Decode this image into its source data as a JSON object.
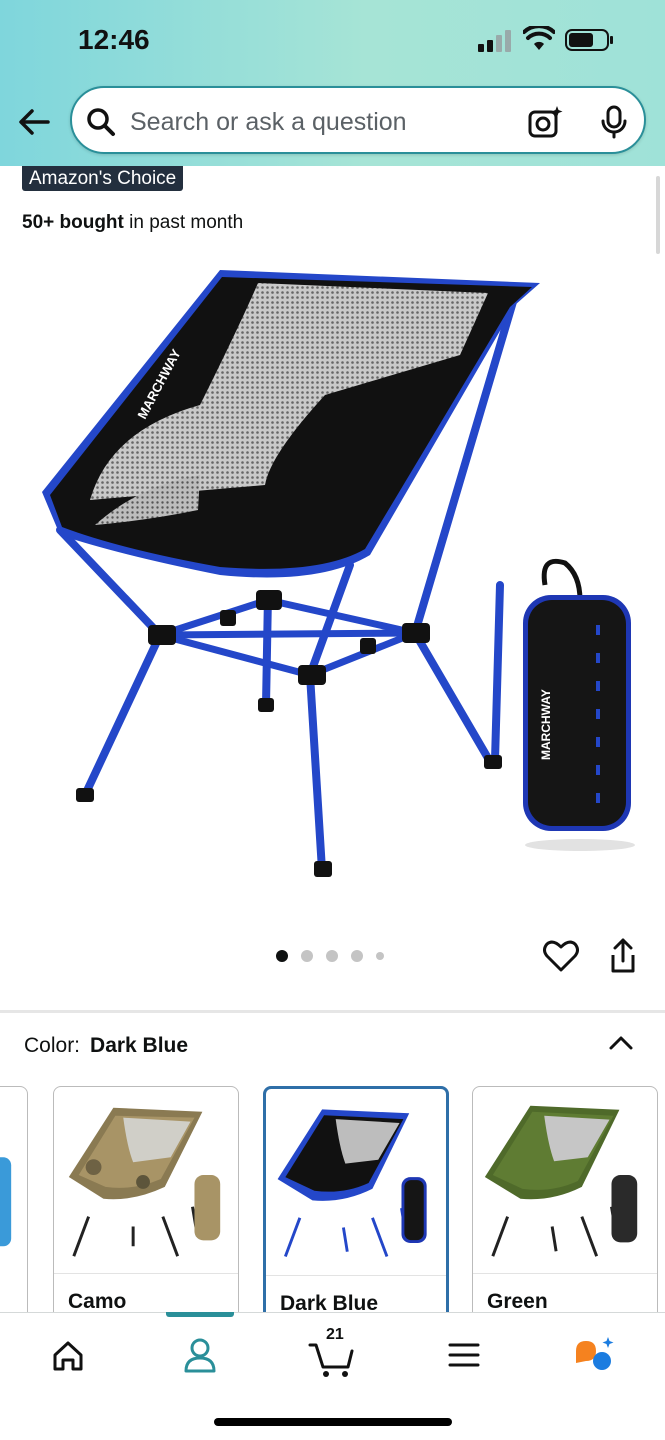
{
  "status_bar": {
    "time": "12:46"
  },
  "search": {
    "placeholder": "Search or ask a question"
  },
  "product": {
    "badge": "Amazon's Choice",
    "bought_bold": "50+ bought",
    "bought_rest": " in past month",
    "image_pages": 5,
    "active_page": 1
  },
  "color_selector": {
    "label": "Color:",
    "selected": "Dark Blue",
    "options": [
      {
        "name": "Camo"
      },
      {
        "name": "Dark Blue"
      },
      {
        "name": "Green"
      }
    ]
  },
  "bottom_nav": {
    "items": [
      "home-icon",
      "account-icon",
      "cart-icon",
      "menu-icon",
      "rufus-icon"
    ],
    "cart_count": "21",
    "active": "account"
  },
  "colors": {
    "header_gradient_start": "#7fd6dc",
    "header_gradient_end": "#9fe2d8",
    "accent": "#2a8f99",
    "badge_bg": "#232f3e",
    "selected_border": "#2f6fa8"
  }
}
